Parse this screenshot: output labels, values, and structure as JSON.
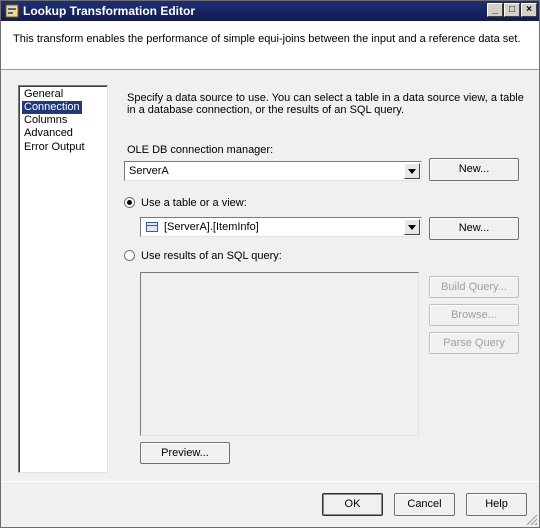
{
  "window": {
    "title": "Lookup Transformation Editor",
    "controls": {
      "minimize": "_",
      "maximize": "□",
      "close": "×"
    }
  },
  "header": {
    "description": "This transform enables the performance of simple equi-joins between the input and a reference data set."
  },
  "nav": {
    "items": [
      {
        "label": "General",
        "selected": false
      },
      {
        "label": "Connection",
        "selected": true
      },
      {
        "label": "Columns",
        "selected": false
      },
      {
        "label": "Advanced",
        "selected": false
      },
      {
        "label": "Error Output",
        "selected": false
      }
    ]
  },
  "connection": {
    "intro": "Specify a data source to use. You can select a table in a data source view, a table in a database connection, or the results of an SQL query.",
    "manager_label": "OLE DB connection manager:",
    "manager_value": "ServerA",
    "manager_new": "New...",
    "use_table_label": "Use a table or a view:",
    "use_table_checked": true,
    "table_value": "[ServerA].[ItemInfo]",
    "table_new": "New...",
    "use_sql_label": "Use results of an SQL query:",
    "use_sql_checked": false,
    "sql_text": "",
    "build_query": "Build Query...",
    "browse": "Browse...",
    "parse_query": "Parse Query",
    "preview": "Preview..."
  },
  "footer": {
    "ok": "OK",
    "cancel": "Cancel",
    "help": "Help"
  },
  "colors": {
    "title_bar": "#1e2f74",
    "selection": "#1e3a7a",
    "dialog_bg": "#f0f0f0"
  }
}
